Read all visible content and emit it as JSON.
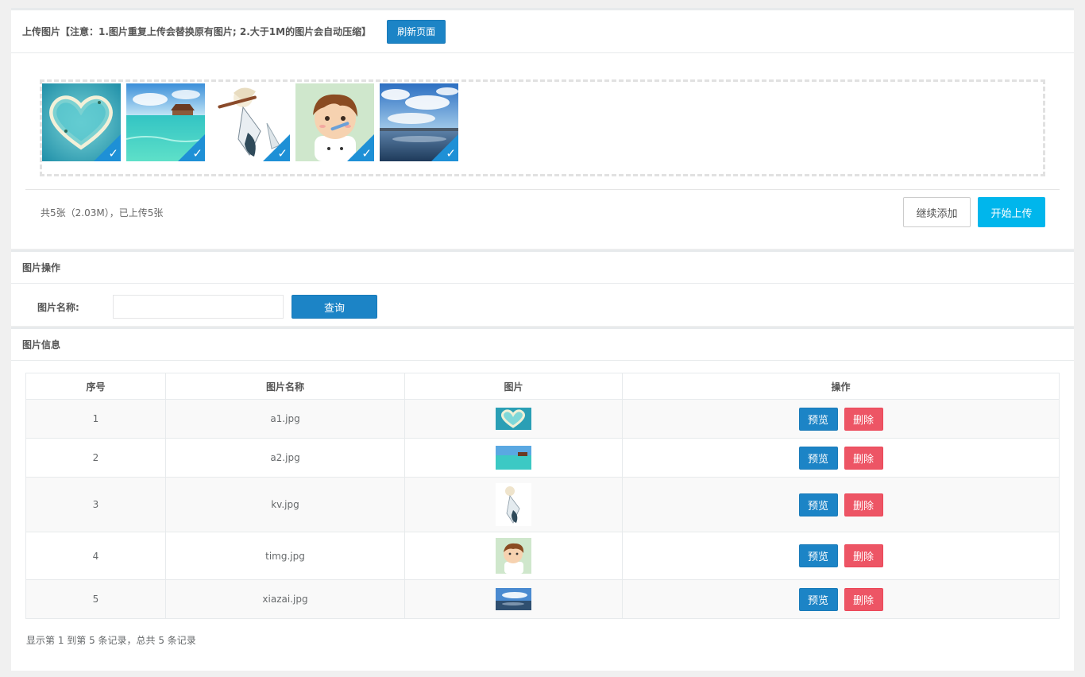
{
  "upload": {
    "title": "上传图片【注意：1.图片重复上传会替换原有图片; 2.大于1M的图片会自动压缩】",
    "refresh_label": "刷新页面",
    "stats": "共5张（2.03M），已上传5张",
    "continue_label": "继续添加",
    "start_label": "开始上传"
  },
  "search": {
    "title": "图片操作",
    "name_label": "图片名称:",
    "name_value": "",
    "query_label": "查询"
  },
  "table": {
    "title": "图片信息",
    "headers": [
      "序号",
      "图片名称",
      "图片",
      "操作"
    ],
    "preview_label": "预览",
    "delete_label": "删除",
    "rows": [
      {
        "index": "1",
        "name": "a1.jpg"
      },
      {
        "index": "2",
        "name": "a2.jpg"
      },
      {
        "index": "3",
        "name": "kv.jpg"
      },
      {
        "index": "4",
        "name": "timg.jpg"
      },
      {
        "index": "5",
        "name": "xiazai.jpg"
      }
    ],
    "footer": "显示第 1 到第 5 条记录，总共 5 条记录"
  },
  "colors": {
    "primary": "#1c84c6",
    "danger": "#ed5565",
    "info": "#00b6ec",
    "check": "#1e90d6"
  }
}
